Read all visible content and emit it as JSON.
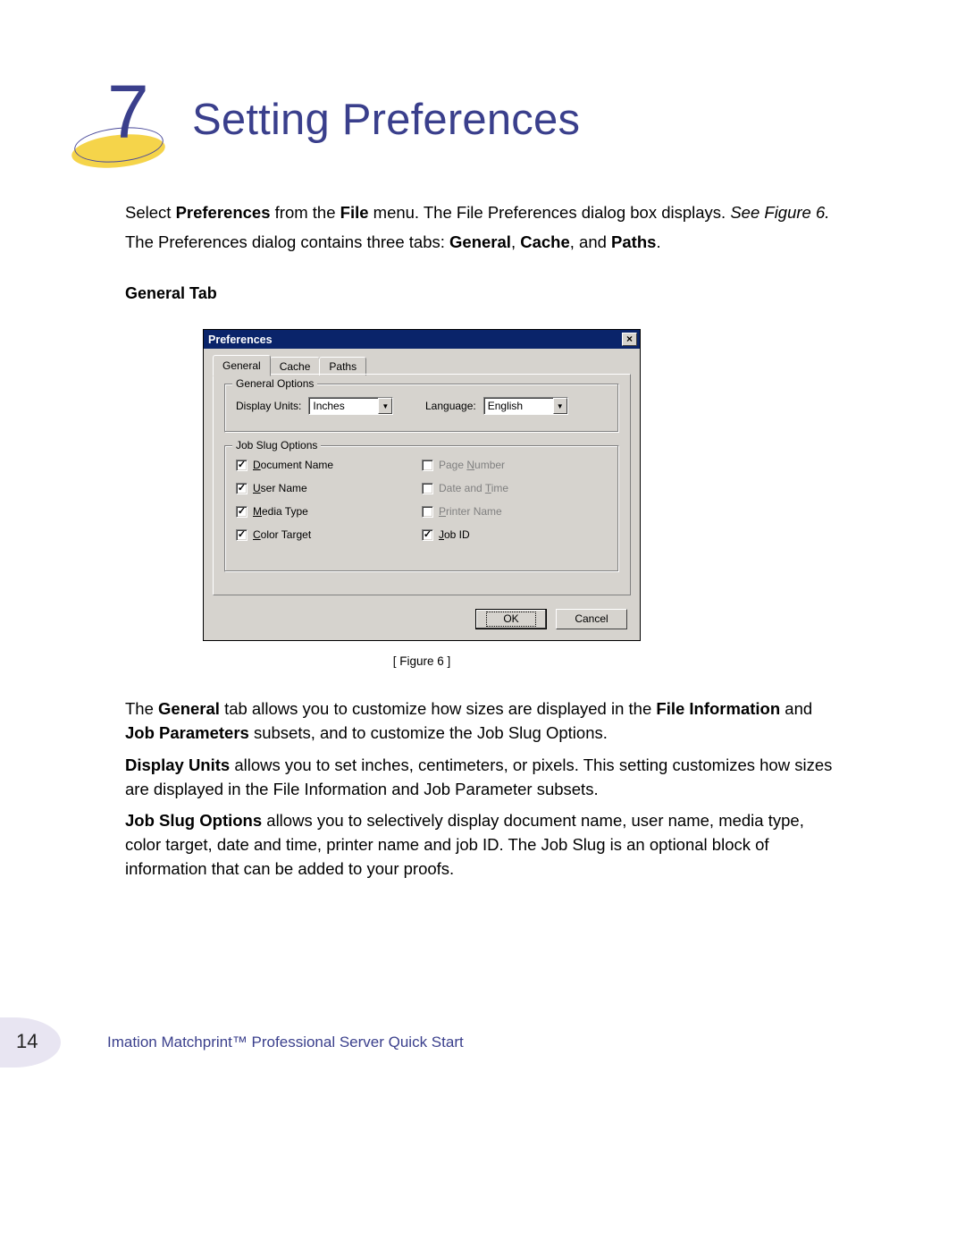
{
  "chapter": {
    "number": "7",
    "title": "Setting Preferences"
  },
  "intro": {
    "line1_a": "Select ",
    "line1_b": "Preferences",
    "line1_c": " from the ",
    "line1_d": "File",
    "line1_e": " menu. The File Preferences dialog box displays. ",
    "line1_f": "See Figure 6.",
    "line2_a": "The Preferences dialog contains three tabs: ",
    "line2_b": "General",
    "line2_c": ", ",
    "line2_d": "Cache",
    "line2_e": ", and ",
    "line2_f": "Paths",
    "line2_g": "."
  },
  "section_heading": "General Tab",
  "dialog": {
    "title": "Preferences",
    "close_glyph": "×",
    "tabs": {
      "general": "General",
      "cache": "Cache",
      "paths": "Paths"
    },
    "general_options": {
      "legend": "General Options",
      "display_units_label": "Display Units:",
      "display_units_value": "Inches",
      "language_label": "Language:",
      "language_value": "English"
    },
    "job_slug": {
      "legend": "Job Slug Options",
      "left": [
        {
          "label": "Document Name",
          "ul": "D",
          "checked": true,
          "disabled": false
        },
        {
          "label": "User Name",
          "ul": "U",
          "checked": true,
          "disabled": false
        },
        {
          "label": "Media Type",
          "ul": "M",
          "checked": true,
          "disabled": false
        },
        {
          "label": "Color Target",
          "ul": "C",
          "checked": true,
          "disabled": false
        }
      ],
      "right": [
        {
          "label": "Page Number",
          "ul": "N",
          "checked": false,
          "disabled": true
        },
        {
          "label": "Date and Time",
          "ul": "T",
          "checked": false,
          "disabled": true
        },
        {
          "label": "Printer Name",
          "ul": "P",
          "checked": false,
          "disabled": true
        },
        {
          "label": "Job ID",
          "ul": "J",
          "checked": true,
          "disabled": false
        }
      ]
    },
    "buttons": {
      "ok": "OK",
      "cancel": "Cancel"
    }
  },
  "figure_caption": "[ Figure 6 ]",
  "para3": {
    "a": "The ",
    "b": "General",
    "c": " tab allows you to customize how sizes are displayed in the ",
    "d": "File Information",
    "e": " and ",
    "f": "Job Parameters",
    "g": " subsets, and to customize the Job Slug Options."
  },
  "para4": {
    "a": "Display Units",
    "b": " allows you to set inches, centimeters, or pixels. This setting customizes how sizes are displayed in the File Information and Job Parameter subsets."
  },
  "para5": {
    "a": "Job Slug Options",
    "b": " allows you to selectively display document name, user name, media type, color target, date and time, printer name and job ID. The Job Slug is an optional block of information that can be added to your proofs."
  },
  "footer": {
    "page_number": "14",
    "text": "Imation Matchprint™ Professional Server Quick Start"
  }
}
